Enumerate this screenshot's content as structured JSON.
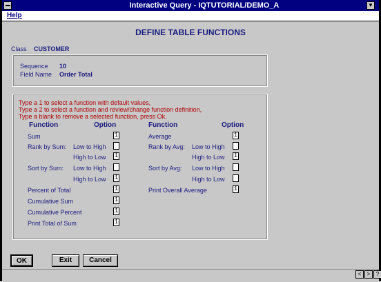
{
  "window": {
    "title": "Interactive Query - IQTUTORIAL/DEMO_A"
  },
  "menu": {
    "help": "Help"
  },
  "heading": "DEFINE TABLE FUNCTIONS",
  "class": {
    "label": "Class",
    "value": "CUSTOMER"
  },
  "sequence": {
    "label": "Sequence",
    "value": "10"
  },
  "field": {
    "label": "Field Name",
    "value": "Order Total"
  },
  "instructions": [
    "Type a 1 to select a function with default values,",
    "Type a 2 to select a function and review/change function definition,",
    "Type a blank to remove a selected function, press Ok."
  ],
  "headers": {
    "function": "Function",
    "option": "Option"
  },
  "left": {
    "sum": "Sum",
    "rank_by_sum": "Rank by Sum:",
    "sort_by_sum": "Sort by Sum:",
    "low_to_high": "Low to High",
    "high_to_low": "High to Low",
    "percent_of_total": "Percent of Total",
    "cumulative_sum": "Cumulative Sum",
    "cumulative_percent": "Cumulative Percent",
    "print_total_of_sum": "Print Total of Sum"
  },
  "right": {
    "average": "Average",
    "rank_by_avg": "Rank by Avg:",
    "sort_by_avg": "Sort by Avg:",
    "low_to_high": "Low to High",
    "high_to_low": "High to Low",
    "print_overall_average": "Print Overall Average"
  },
  "options": {
    "sum": "1",
    "rank_sum_low": "",
    "rank_sum_high": "1",
    "sort_sum_low": "",
    "sort_sum_high": "1",
    "percent_of_total": "1",
    "cumulative_sum": "1",
    "cumulative_percent": "1",
    "print_total_of_sum": "1",
    "average": "1",
    "rank_avg_low": "",
    "rank_avg_high": "1",
    "sort_avg_low": "",
    "sort_avg_high": "",
    "print_overall_average": "1"
  },
  "buttons": {
    "ok": "OK",
    "exit": "Exit",
    "cancel": "Cancel"
  },
  "status_buttons": {
    "prev": "<",
    "next": ">",
    "help": "?"
  }
}
